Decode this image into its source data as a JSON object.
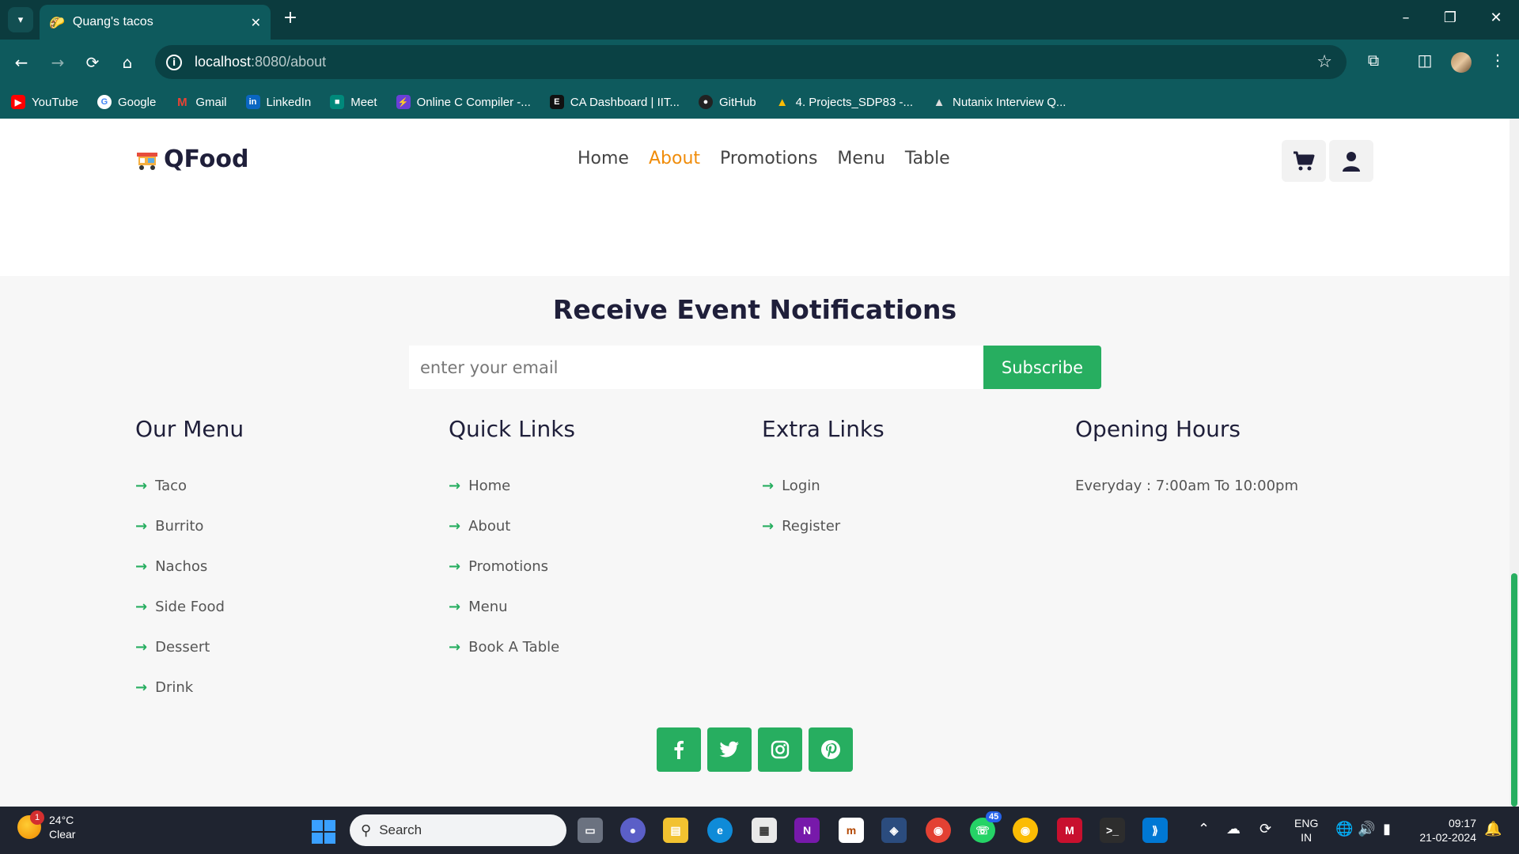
{
  "browser": {
    "tab": {
      "title": "Quang's tacos"
    },
    "url": {
      "host": "localhost",
      "path": ":8080/about"
    },
    "bookmarks": [
      {
        "label": "YouTube",
        "icon": "youtube-icon",
        "color": "#ff0000"
      },
      {
        "label": "Google",
        "icon": "google-icon",
        "color": "#4285f4"
      },
      {
        "label": "Gmail",
        "icon": "gmail-icon",
        "color": "#ea4335"
      },
      {
        "label": "LinkedIn",
        "icon": "linkedin-icon",
        "color": "#0a66c2"
      },
      {
        "label": "Meet",
        "icon": "meet-icon",
        "color": "#00897b"
      },
      {
        "label": "Online C Compiler -...",
        "icon": "compiler-icon",
        "color": "#6a3fd8"
      },
      {
        "label": "CA Dashboard | IIT...",
        "icon": "dashboard-icon",
        "color": "#111111"
      },
      {
        "label": "GitHub",
        "icon": "github-icon",
        "color": "#222222"
      },
      {
        "label": "4. Projects_SDP83 -...",
        "icon": "drive-icon",
        "color": "#fbbc04"
      },
      {
        "label": "Nutanix Interview Q...",
        "icon": "mountain-icon",
        "color": "#cccccc"
      }
    ]
  },
  "site": {
    "logo": "QFood",
    "nav": [
      "Home",
      "About",
      "Promotions",
      "Menu",
      "Table"
    ],
    "active_nav": "About",
    "accent": "#27ae60",
    "nav_active_color": "#f08c0a"
  },
  "notifications": {
    "title": "Receive Event Notifications",
    "email_placeholder": "enter your email",
    "subscribe_label": "Subscribe"
  },
  "footer": {
    "our_menu": {
      "title": "Our Menu",
      "items": [
        "Taco",
        "Burrito",
        "Nachos",
        "Side Food",
        "Dessert",
        "Drink"
      ]
    },
    "quick_links": {
      "title": "Quick Links",
      "items": [
        "Home",
        "About",
        "Promotions",
        "Menu",
        "Book A Table"
      ]
    },
    "extra_links": {
      "title": "Extra Links",
      "items": [
        "Login",
        "Register"
      ]
    },
    "opening_hours": {
      "title": "Opening Hours",
      "text": "Everyday : 7:00am To 10:00pm"
    },
    "socials": [
      "facebook-icon",
      "twitter-icon",
      "instagram-icon",
      "pinterest-icon"
    ]
  },
  "taskbar": {
    "weather": {
      "temp": "24°C",
      "condition": "Clear",
      "badge": "1"
    },
    "search_placeholder": "Search",
    "whatsapp_badge": "45",
    "lang": {
      "line1": "ENG",
      "line2": "IN"
    },
    "clock": {
      "time": "09:17",
      "date": "21-02-2024"
    }
  }
}
